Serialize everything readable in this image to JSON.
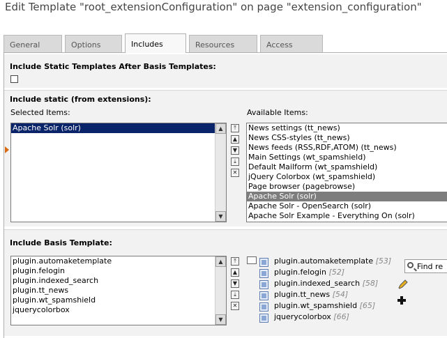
{
  "page": {
    "title": "Edit Template \"root_extensionConfiguration\" on page \"extension_configuration\""
  },
  "tabs": [
    {
      "label": "General",
      "active": false
    },
    {
      "label": "Options",
      "active": false
    },
    {
      "label": "Includes",
      "active": true
    },
    {
      "label": "Resources",
      "active": false
    },
    {
      "label": "Access",
      "active": false
    }
  ],
  "static_after_basis": {
    "header": "Include Static Templates After Basis Templates:",
    "checked": false
  },
  "include_static": {
    "header": "Include static (from extensions):",
    "selected_label": "Selected Items:",
    "available_label": "Available Items:",
    "selected_items": [
      "Apache Solr (solr)"
    ],
    "available_items": [
      "News settings (tt_news)",
      "News CSS-styles (tt_news)",
      "News feeds (RSS,RDF,ATOM) (tt_news)",
      "Main Settings (wt_spamshield)",
      "Default Mailform (wt_spamshield)",
      "jQuery Colorbox (wt_spamshield)",
      "Page browser (pagebrowse)",
      "Apache Solr (solr)",
      "Apache Solr - OpenSearch (solr)",
      "Apache Solr Example - Everything On (solr)"
    ],
    "highlighted_available_index": 7,
    "controls": [
      "move-top",
      "move-up",
      "move-down",
      "move-bottom",
      "remove"
    ]
  },
  "include_basis": {
    "header": "Include Basis Template:",
    "selected_items": [
      "plugin.automaketemplate",
      "plugin.felogin",
      "plugin.indexed_search",
      "plugin.tt_news",
      "plugin.wt_spamshield",
      "jquerycolorbox"
    ],
    "tree_items": [
      {
        "label": "plugin.automaketemplate",
        "index": "[53]"
      },
      {
        "label": "plugin.felogin",
        "index": "[52]"
      },
      {
        "label": "plugin.indexed_search",
        "index": "[58]"
      },
      {
        "label": "plugin.tt_news",
        "index": "[54]"
      },
      {
        "label": "plugin.wt_spamshield",
        "index": "[65]"
      },
      {
        "label": "jquerycolorbox",
        "index": "[66]"
      }
    ],
    "find_label": "Find re"
  },
  "colors": {
    "selected_bg": "#0a246a",
    "highlight_bg": "#7d7d7d",
    "section_bg": "#f2f2f2",
    "marker": "#d96a10"
  }
}
